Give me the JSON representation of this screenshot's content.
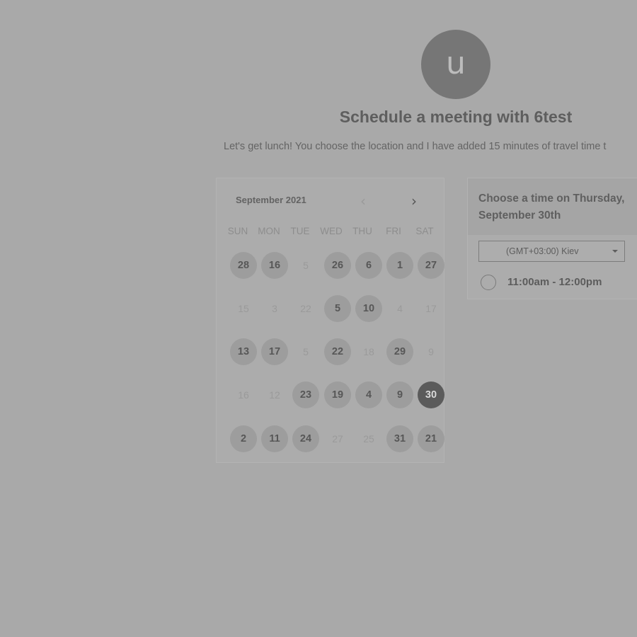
{
  "avatar": {
    "initial": "u"
  },
  "title": "Schedule a meeting with 6test",
  "description": "Let's get lunch! You choose the location and I have added 15 minutes of travel time t",
  "calendar": {
    "month_label": "September 2021",
    "prev_icon": "chevron-left-icon",
    "next_icon": "chevron-right-icon",
    "prev_glyph": "‹",
    "next_glyph": "›",
    "weekdays": [
      "SUN",
      "MON",
      "TUE",
      "WED",
      "THU",
      "FRI",
      "SAT"
    ],
    "weeks": [
      [
        {
          "d": "28",
          "s": "avail"
        },
        {
          "d": "16",
          "s": "avail"
        },
        {
          "d": "5",
          "s": "disabled"
        },
        {
          "d": "26",
          "s": "avail"
        },
        {
          "d": "6",
          "s": "avail"
        },
        {
          "d": "1",
          "s": "avail"
        },
        {
          "d": "27",
          "s": "avail"
        }
      ],
      [
        {
          "d": "15",
          "s": "disabled"
        },
        {
          "d": "3",
          "s": "disabled"
        },
        {
          "d": "22",
          "s": "disabled"
        },
        {
          "d": "5",
          "s": "avail"
        },
        {
          "d": "10",
          "s": "avail"
        },
        {
          "d": "4",
          "s": "disabled"
        },
        {
          "d": "17",
          "s": "disabled"
        }
      ],
      [
        {
          "d": "13",
          "s": "avail"
        },
        {
          "d": "17",
          "s": "avail"
        },
        {
          "d": "5",
          "s": "disabled"
        },
        {
          "d": "22",
          "s": "avail"
        },
        {
          "d": "18",
          "s": "disabled"
        },
        {
          "d": "29",
          "s": "avail"
        },
        {
          "d": "9",
          "s": "disabled"
        }
      ],
      [
        {
          "d": "16",
          "s": "disabled"
        },
        {
          "d": "12",
          "s": "disabled"
        },
        {
          "d": "23",
          "s": "avail"
        },
        {
          "d": "19",
          "s": "avail"
        },
        {
          "d": "4",
          "s": "avail"
        },
        {
          "d": "9",
          "s": "avail"
        },
        {
          "d": "30",
          "s": "selected"
        }
      ],
      [
        {
          "d": "2",
          "s": "avail"
        },
        {
          "d": "11",
          "s": "avail"
        },
        {
          "d": "24",
          "s": "avail"
        },
        {
          "d": "27",
          "s": "disabled"
        },
        {
          "d": "25",
          "s": "disabled"
        },
        {
          "d": "31",
          "s": "avail"
        },
        {
          "d": "21",
          "s": "avail"
        }
      ]
    ]
  },
  "time_panel": {
    "heading": "Choose a time on Thursday, September 30th",
    "timezone": "(GMT+03:00) Kiev",
    "slots": [
      {
        "label": "11:00am - 12:00pm"
      }
    ]
  },
  "colors": {
    "background": "#a9a9a9",
    "selected_day": "#5b5b5b",
    "available_day": "#9d9d9d"
  }
}
